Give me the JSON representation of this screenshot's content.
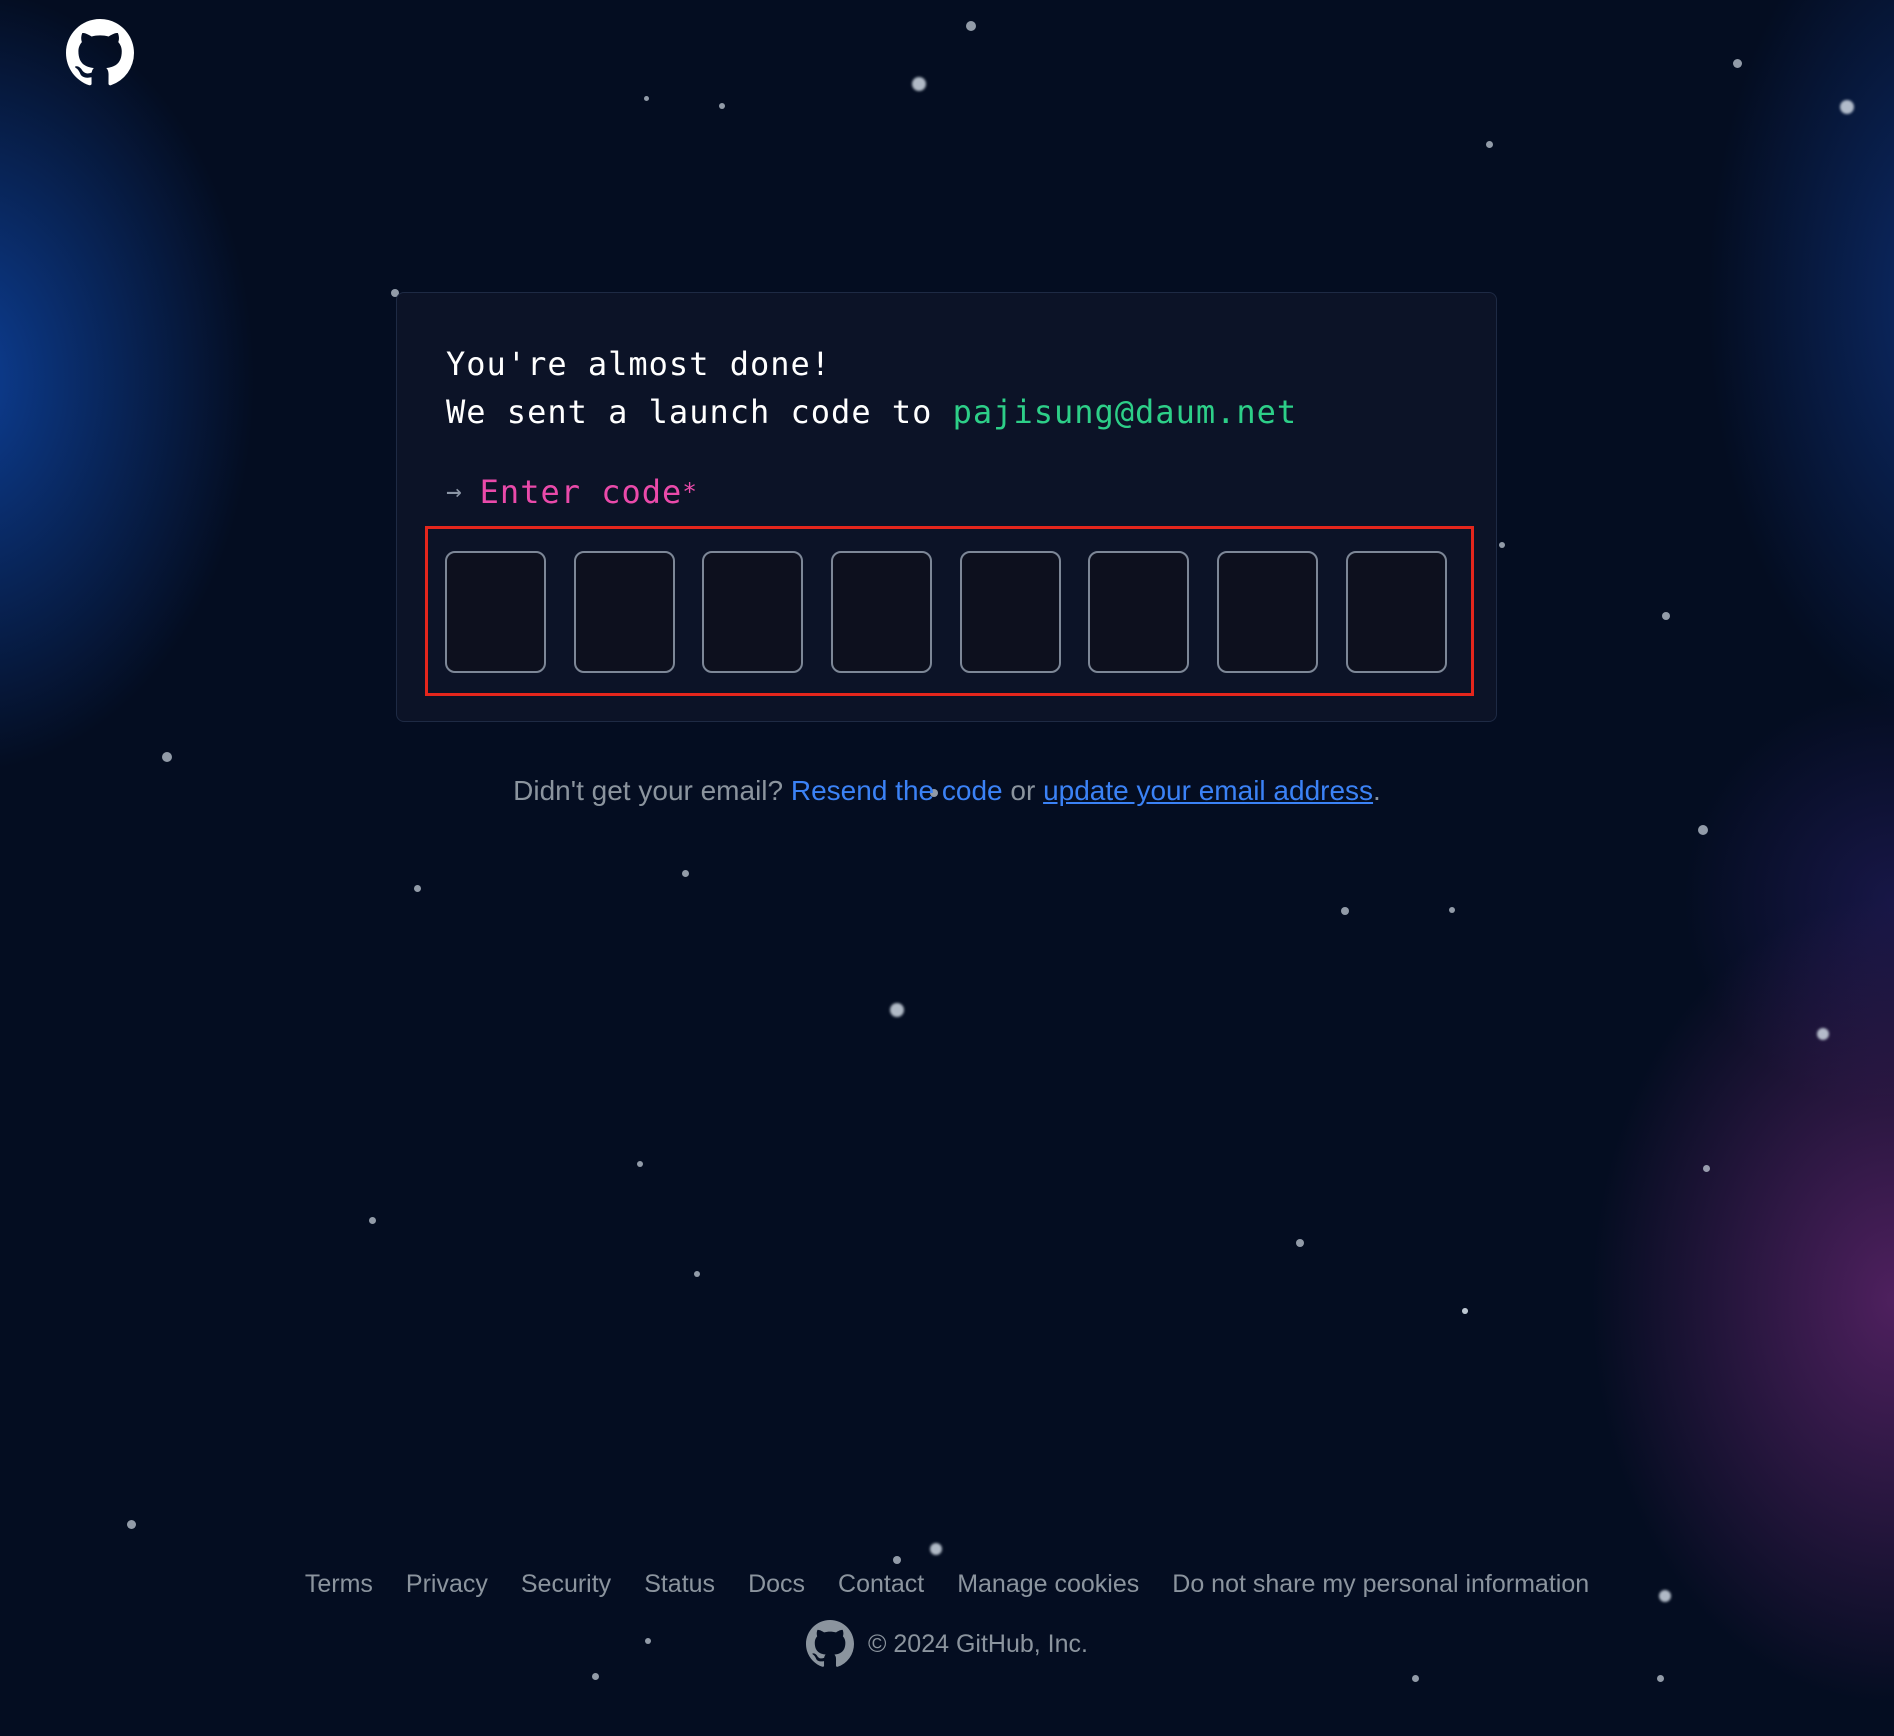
{
  "header": {
    "logo_icon": "github-octocat-icon"
  },
  "card": {
    "line1": "You're almost done!",
    "line2_prefix": "We sent a launch code to ",
    "email": "pajisung@daum.net",
    "prompt_arrow": "→",
    "enter_label": "Enter code",
    "required_marker": "*",
    "code_digits": [
      "",
      "",
      "",
      "",
      "",
      "",
      "",
      ""
    ]
  },
  "resend": {
    "prefix": "Didn't get your email? ",
    "resend_link": "Resend the code",
    "middle": " or ",
    "update_link": "update your email address",
    "suffix": "."
  },
  "footer": {
    "links": [
      "Terms",
      "Privacy",
      "Security",
      "Status",
      "Docs",
      "Contact",
      "Manage cookies",
      "Do not share my personal information"
    ],
    "copyright": "© 2024 GitHub, Inc."
  },
  "colors": {
    "background": "#040d21",
    "email": "#2dcf88",
    "label_pink": "#ea4aaa",
    "link_blue": "#3b82f6",
    "highlight_red": "#e5261c"
  }
}
